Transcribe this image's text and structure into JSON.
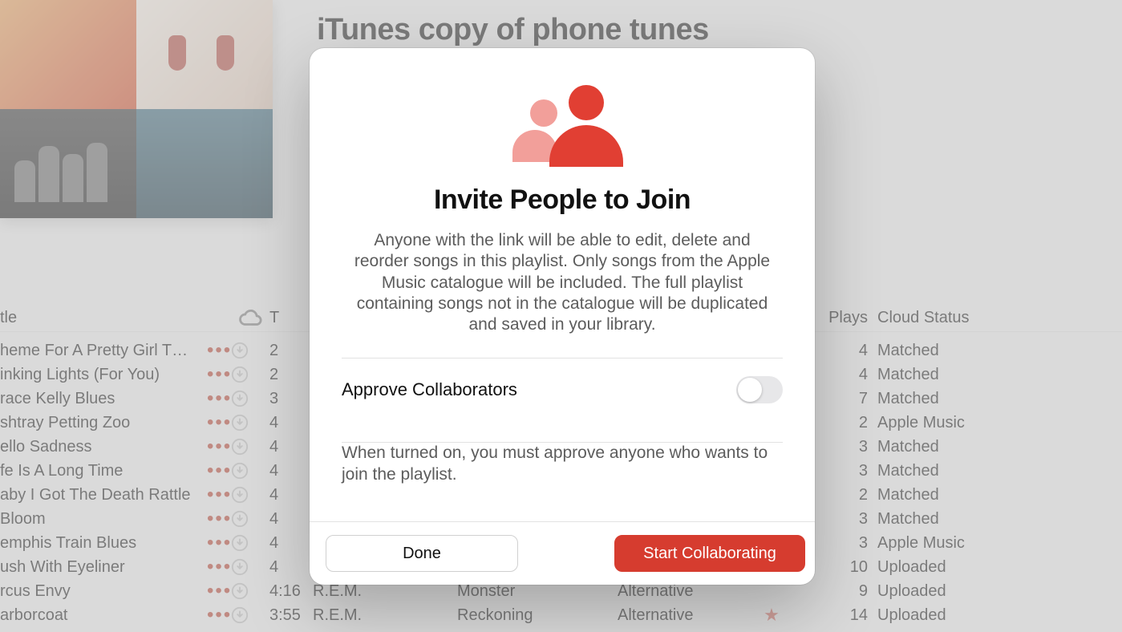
{
  "playlist": {
    "title": "iTunes copy of phone tunes"
  },
  "columns": {
    "title": "tle",
    "cloud": "cloud-icon",
    "time": "T",
    "star": "☆",
    "plays": "Plays",
    "cloud_status": "Cloud Status"
  },
  "tracks": [
    {
      "title": "heme For A Pretty Girl That...",
      "time": "2",
      "artist": "",
      "album": "",
      "genre": "",
      "starred": false,
      "plays": 4,
      "cloud": "Matched"
    },
    {
      "title": "inking Lights (For You)",
      "time": "2",
      "artist": "",
      "album": "",
      "genre": "",
      "starred": false,
      "plays": 4,
      "cloud": "Matched"
    },
    {
      "title": "race Kelly Blues",
      "time": "3",
      "artist": "",
      "album": "",
      "genre": "",
      "starred": true,
      "plays": 7,
      "cloud": "Matched"
    },
    {
      "title": "shtray Petting Zoo",
      "time": "4",
      "artist": "",
      "album": "",
      "genre": "",
      "starred": false,
      "plays": 2,
      "cloud": "Apple Music"
    },
    {
      "title": "ello Sadness",
      "time": "4",
      "artist": "",
      "album": "",
      "genre": "",
      "starred": true,
      "plays": 3,
      "cloud": "Matched"
    },
    {
      "title": "fe Is A Long Time",
      "time": "4",
      "artist": "",
      "album": "",
      "genre": "",
      "starred": false,
      "plays": 3,
      "cloud": "Matched"
    },
    {
      "title": "aby I Got The Death Rattle",
      "time": "4",
      "artist": "",
      "album": "",
      "genre": "",
      "starred": false,
      "plays": 2,
      "cloud": "Matched"
    },
    {
      "title": " Bloom",
      "time": "4",
      "artist": "",
      "album": "",
      "genre": "",
      "starred": false,
      "plays": 3,
      "cloud": "Matched"
    },
    {
      "title": "emphis Train Blues",
      "time": "4",
      "artist": "",
      "album": "",
      "genre": "",
      "starred": false,
      "plays": 3,
      "cloud": "Apple Music"
    },
    {
      "title": "ush With Eyeliner",
      "time": "4",
      "artist": "",
      "album": "",
      "genre": "",
      "starred": true,
      "plays": 10,
      "cloud": "Uploaded"
    },
    {
      "title": "rcus Envy",
      "time": "4:16",
      "artist": "R.E.M.",
      "album": "Monster",
      "genre": "Alternative",
      "starred": false,
      "plays": 9,
      "cloud": "Uploaded"
    },
    {
      "title": "arborcoat",
      "time": "3:55",
      "artist": "R.E.M.",
      "album": "Reckoning",
      "genre": "Alternative",
      "starred": true,
      "plays": 14,
      "cloud": "Uploaded"
    }
  ],
  "modal": {
    "title": "Invite People to Join",
    "description": "Anyone with the link will be able to edit, delete and reorder songs in this playlist. Only songs from the Apple Music catalogue will be included. The full playlist containing songs not in the catalogue will be duplicated and saved in your library.",
    "approve_label": "Approve Collaborators",
    "approve_on": false,
    "approve_description": "When turned on, you must approve anyone who wants to join the playlist.",
    "done_label": "Done",
    "start_label": "Start Collaborating"
  }
}
